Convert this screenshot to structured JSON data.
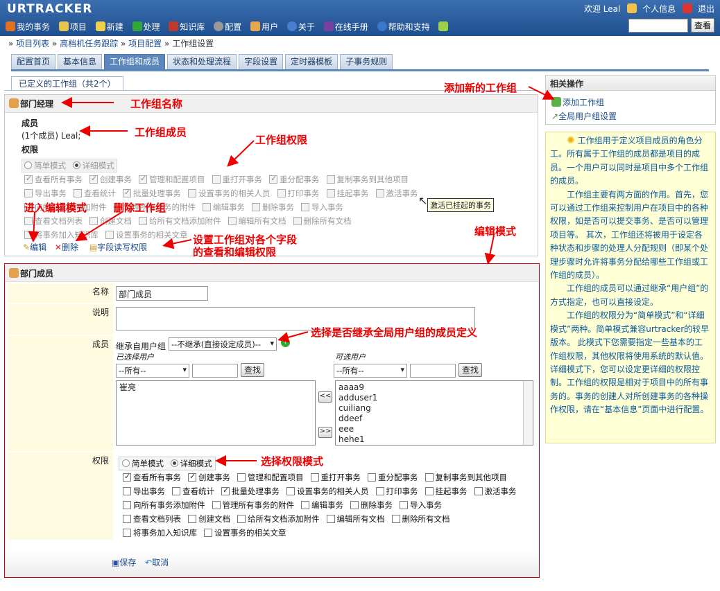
{
  "header": {
    "logo": "URTRACKER",
    "user": "欢迎 Leal",
    "profile": "个人信息",
    "logout": "退出",
    "nav": [
      "我的事务",
      "项目",
      "新建",
      "处理",
      "知识库",
      "配置",
      "用户",
      "关于",
      "在线手册",
      "帮助和支持"
    ],
    "search_button": "查看"
  },
  "breadcrumb": {
    "sep": "»",
    "items": [
      "项目列表",
      "高档机任务跟踪",
      "项目配置"
    ],
    "current": "工作组设置"
  },
  "tabs": [
    "配置首页",
    "基本信息",
    "工作组和成员",
    "状态和处理流程",
    "字段设置",
    "定时器模板",
    "子事务规则"
  ],
  "subtab": "已定义的工作组（共2个）",
  "group": {
    "name": "部门经理",
    "members_label": "成员",
    "members": "(1个成员) Leal;",
    "perm_label": "权限",
    "mode_simple": "简单模式",
    "mode_detail": "详细模式",
    "rows": [
      [
        {
          "t": "查看所有事务",
          "c": true
        },
        {
          "t": "创建事务",
          "c": true
        },
        {
          "t": "管理和配置项目",
          "c": true
        },
        {
          "t": "重打开事务",
          "c": false
        },
        {
          "t": "重分配事务",
          "c": true
        },
        {
          "t": "复制事务到其他项目",
          "c": false
        }
      ],
      [
        {
          "t": "导出事务",
          "c": false
        },
        {
          "t": "查看统计",
          "c": false
        },
        {
          "t": "批量处理事务",
          "c": true
        },
        {
          "t": "设置事务的相关人员",
          "c": false
        },
        {
          "t": "打印事务",
          "c": false
        },
        {
          "t": "挂起事务",
          "c": false
        },
        {
          "t": "激活事务",
          "c": false
        }
      ],
      [
        {
          "t": "向所有事务添加附件",
          "c": false
        },
        {
          "t": "管理所有事务的附件",
          "c": false
        },
        {
          "t": "编辑事务",
          "c": false
        },
        {
          "t": "删除事务",
          "c": false
        },
        {
          "t": "导入事务",
          "c": false
        }
      ],
      [
        {
          "t": "查看文档列表",
          "c": false
        },
        {
          "t": "创建文档",
          "c": false
        },
        {
          "t": "给所有文档添加附件",
          "c": false
        },
        {
          "t": "编辑所有文档",
          "c": false
        },
        {
          "t": "删除所有文档",
          "c": false
        }
      ],
      [
        {
          "t": "将事务加入知识库",
          "c": false
        },
        {
          "t": "设置事务的相关文章",
          "c": false
        }
      ]
    ],
    "edit": "编辑",
    "delete": "删除",
    "field_perm": "字段读写权限",
    "tooltip": "激活已挂起的事务"
  },
  "edit_form": {
    "title": "部门成员",
    "name_label": "名称",
    "name_value": "部门成员",
    "desc_label": "说明",
    "member_label": "成员",
    "inherit_label": "继承自用户组",
    "inherit_value": "--不继承(直接设定成员)--",
    "selected_label": "已选择用户",
    "available_label": "可选用户",
    "filter_all": "--所有--",
    "find": "查找",
    "selected_users": [
      "崔亮"
    ],
    "available_users": [
      "aaaa9",
      "adduser1",
      "cuiliang",
      "ddeef",
      "eee",
      "hehe1"
    ],
    "move_left": "<<",
    "move_right": ">>",
    "perm_label": "权限",
    "mode_simple": "简单模式",
    "mode_detail": "详细模式",
    "rows": [
      [
        {
          "t": "查看所有事务",
          "c": true
        },
        {
          "t": "创建事务",
          "c": true
        },
        {
          "t": "管理和配置项目",
          "c": false
        },
        {
          "t": "重打开事务",
          "c": false
        },
        {
          "t": "重分配事务",
          "c": false
        },
        {
          "t": "复制事务到其他项目",
          "c": false
        }
      ],
      [
        {
          "t": "导出事务",
          "c": false
        },
        {
          "t": "查看统计",
          "c": false
        },
        {
          "t": "批量处理事务",
          "c": true
        },
        {
          "t": "设置事务的相关人员",
          "c": false
        },
        {
          "t": "打印事务",
          "c": false
        },
        {
          "t": "挂起事务",
          "c": false
        },
        {
          "t": "激活事务",
          "c": false
        }
      ],
      [
        {
          "t": "向所有事务添加附件",
          "c": false
        },
        {
          "t": "管理所有事务的附件",
          "c": false
        },
        {
          "t": "编辑事务",
          "c": false
        },
        {
          "t": "删除事务",
          "c": false
        },
        {
          "t": "导入事务",
          "c": false
        }
      ],
      [
        {
          "t": "查看文档列表",
          "c": false
        },
        {
          "t": "创建文档",
          "c": false
        },
        {
          "t": "给所有文档添加附件",
          "c": false
        },
        {
          "t": "编辑所有文档",
          "c": false
        },
        {
          "t": "删除所有文档",
          "c": false
        }
      ],
      [
        {
          "t": "将事务加入知识库",
          "c": false
        },
        {
          "t": "设置事务的相关文章",
          "c": false
        }
      ]
    ],
    "save": "保存",
    "cancel": "取消"
  },
  "sidebar": {
    "title": "相关操作",
    "add_group": "添加工作组",
    "global_group": "全局用户组设置",
    "help": [
      "工作组用于定义项目成员的角色分工。所有属于工作组的成员都是项目的成员。一个用户可以同时是项目中多个工作组的成员。",
      "工作组主要有两方面的作用。首先，您可以通过工作组来控制用户在项目中的各种权限，如是否可以提交事务、是否可以管理项目等。 其次，工作组还将被用于设定各种状态和步骤的处理人分配规则（即某个处理步骤时允许将事务分配给哪些工作组或工作组的成员）。",
      "工作组的成员可以通过继承“用户组”的方式指定，也可以直接设定。",
      "工作组的权限分为“简单模式”和“详细模式”两种。简单模式兼容urtracker的较早版本。 此模式下您需要指定一些基本的工作组权限，其他权限将使用系统的默认值。 详细模式下，您可以设定更详细的权限控制。工作组的权限是相对于项目中的所有事务的。事务的创建人对所创建事务的各种操作权限，请在“基本信息”页面中进行配置。"
    ]
  },
  "annotations": {
    "group_name": "工作组名称",
    "group_members": "工作组成员",
    "group_perm": "工作组权限",
    "enter_edit": "进入编辑模式",
    "delete_group": "删除工作组",
    "field_perm": "设置工作组对各个字段\n的查看和编辑权限",
    "edit_mode": "编辑模式",
    "add_group": "添加新的工作组",
    "inherit": "选择是否继承全局用户组的成员定义",
    "perm_mode": "选择权限模式"
  }
}
